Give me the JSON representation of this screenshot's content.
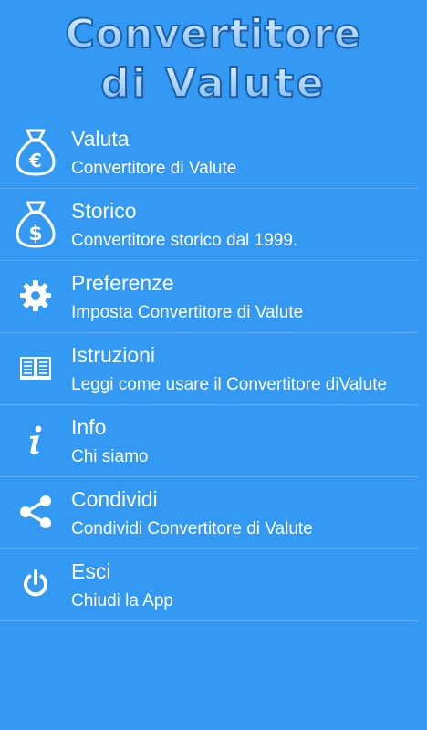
{
  "header": {
    "logo_line1": "Convertitore",
    "logo_line2": "di Valute"
  },
  "menu": {
    "items": [
      {
        "title": "Valuta",
        "subtitle": "Convertitore di Valute",
        "icon": "euro-money-bag-icon"
      },
      {
        "title": "Storico",
        "subtitle": "Convertitore storico dal 1999.",
        "icon": "dollar-money-bag-icon"
      },
      {
        "title": "Preferenze",
        "subtitle": "Imposta Convertitore di Valute",
        "icon": "gear-icon"
      },
      {
        "title": "Istruzioni",
        "subtitle": "Leggi come usare il Convertitore diValute",
        "icon": "book-icon"
      },
      {
        "title": "Info",
        "subtitle": "Chi siamo",
        "icon": "info-icon"
      },
      {
        "title": "Condividi",
        "subtitle": "Condividi Convertitore di Valute",
        "icon": "share-icon"
      },
      {
        "title": "Esci",
        "subtitle": "Chiudi la App",
        "icon": "power-icon"
      }
    ]
  },
  "colors": {
    "background": "#3399f3",
    "text": "#ffffff",
    "logo_fill": "#a9d4fb",
    "logo_stroke": "#1f5fa7"
  }
}
